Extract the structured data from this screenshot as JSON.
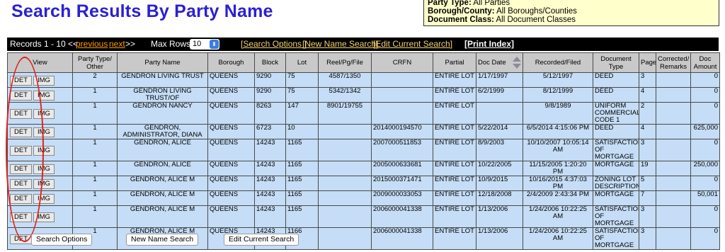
{
  "page": {
    "title": "Search Results By Party Name"
  },
  "criteria": {
    "party_type_label": "Party Type:",
    "party_type_value": "All Parties",
    "borough_label": "Borough/County:",
    "borough_value": "All Boroughs/Counties",
    "doc_class_label": "Document Class:",
    "doc_class_value": "All Document Classes"
  },
  "toolbar": {
    "records": "Records 1 - 10 <<",
    "previous": "previous",
    "next": "next",
    "next_suffix": ">>",
    "max_rows_label": "Max Rows",
    "max_rows_value": "10",
    "search_options": "[Search Options ]",
    "new_name_search": "[New Name Search]",
    "edit_current_search": "[Edit Current Search]",
    "print_index": "[Print Index]"
  },
  "table": {
    "headers": [
      "View",
      "Party Type/ Other",
      "Party Name",
      "Borough",
      "Block",
      "Lot",
      "Reel/Pg/File",
      "CRFN",
      "Partial",
      "Doc Date",
      "Recorded/Filed",
      "Document Type",
      "Pages",
      "Corrected/ Remarks",
      "Doc Amount"
    ],
    "det_label": "DET",
    "img_label": "IMG",
    "rows": [
      {
        "party_type": "2",
        "party_name": "GENDRON LIVING TRUST",
        "borough": "QUEENS",
        "block": "9290",
        "lot": "75",
        "reel": "4587/1350",
        "crfn": "",
        "partial": "ENTIRE LOT",
        "doc_date": "1/17/1997",
        "recorded": "5/12/1997",
        "doc_type": "DEED",
        "pages": "3",
        "remarks": "",
        "amount": "0"
      },
      {
        "party_type": "1",
        "party_name": "GENDRON LIVING TRUST/OF",
        "borough": "QUEENS",
        "block": "9290",
        "lot": "75",
        "reel": "5342/1342",
        "crfn": "",
        "partial": "ENTIRE LOT",
        "doc_date": "6/2/1999",
        "recorded": "8/12/1999",
        "doc_type": "DEED",
        "pages": "4",
        "remarks": "",
        "amount": "0"
      },
      {
        "party_type": "1",
        "party_name": "GENDRON NANCY",
        "borough": "QUEENS",
        "block": "8263",
        "lot": "147",
        "reel": "8901/19755",
        "crfn": "",
        "partial": "ENTIRE LOT",
        "doc_date": "",
        "recorded": "9/8/1989",
        "doc_type": "UNIFORM COMMERCIAL CODE 1",
        "pages": "2",
        "remarks": "",
        "amount": "0"
      },
      {
        "party_type": "1",
        "party_name": "GENDRON, ADMINISTRATOR, DIANA",
        "borough": "QUEENS",
        "block": "6723",
        "lot": "10",
        "reel": "",
        "crfn": "2014000194570",
        "partial": "ENTIRE LOT",
        "doc_date": "5/22/2014",
        "recorded": "6/5/2014 4:15:06 PM",
        "doc_type": "DEED",
        "pages": "4",
        "remarks": "",
        "amount": "625,000"
      },
      {
        "party_type": "1",
        "party_name": "GENDRON, ALICE",
        "borough": "QUEENS",
        "block": "14243",
        "lot": "1165",
        "reel": "",
        "crfn": "2007000511853",
        "partial": "ENTIRE LOT",
        "doc_date": "8/9/2003",
        "recorded": "10/10/2007 10:05:14 AM",
        "doc_type": "SATISFACTION OF MORTGAGE",
        "pages": "3",
        "remarks": "",
        "amount": "0"
      },
      {
        "party_type": "1",
        "party_name": "GENDRON, ALICE",
        "borough": "QUEENS",
        "block": "14243",
        "lot": "1165",
        "reel": "",
        "crfn": "2005000633681",
        "partial": "ENTIRE LOT",
        "doc_date": "10/22/2005",
        "recorded": "11/15/2005 1:20:20 PM",
        "doc_type": "MORTGAGE",
        "pages": "19",
        "remarks": "",
        "amount": "250,000"
      },
      {
        "party_type": "1",
        "party_name": "GENDRON, ALICE M",
        "borough": "QUEENS",
        "block": "14243",
        "lot": "1165",
        "reel": "",
        "crfn": "2015000371471",
        "partial": "ENTIRE LOT",
        "doc_date": "10/9/2015",
        "recorded": "10/16/2015 4:37:03 PM",
        "doc_type": "ZONING LOT DESCRIPTION",
        "pages": "5",
        "remarks": "",
        "amount": "0"
      },
      {
        "party_type": "1",
        "party_name": "GENDRON, ALICE M",
        "borough": "QUEENS",
        "block": "14243",
        "lot": "1165",
        "reel": "",
        "crfn": "2009000033053",
        "partial": "ENTIRE LOT",
        "doc_date": "12/18/2008",
        "recorded": "2/4/2009 2:43:34 PM",
        "doc_type": "MORTGAGE",
        "pages": "7",
        "remarks": "",
        "amount": "50,001"
      },
      {
        "party_type": "1",
        "party_name": "GENDRON, ALICE M",
        "borough": "QUEENS",
        "block": "14243",
        "lot": "1165",
        "reel": "",
        "crfn": "2006000041338",
        "partial": "ENTIRE LOT",
        "doc_date": "1/13/2006",
        "recorded": "1/24/2006 10:22:25 AM",
        "doc_type": "SATISFACTION OF MORTGAGE",
        "pages": "3",
        "remarks": "",
        "amount": "0"
      },
      {
        "party_type": "1",
        "party_name": "GENDRON, ALICE M",
        "borough": "QUEENS",
        "block": "14243",
        "lot": "1166",
        "reel": "",
        "crfn": "2006000041338",
        "partial": "ENTIRE LOT",
        "doc_date": "1/13/2006",
        "recorded": "1/24/2006 10:22:25 AM",
        "doc_type": "SATISFACTION OF MORTGAGE",
        "pages": "3",
        "remarks": "",
        "amount": "0"
      }
    ]
  },
  "bottom": {
    "search_options": "Search Options",
    "new_name_search": "New Name Search",
    "edit_current_search": "Edit Current Search"
  },
  "colors": {
    "title": "#2a1fd6",
    "criteria_bg": "#ffffcc",
    "row_bg": "#c5ddf6",
    "header_bg": "#c9c9c9",
    "link": "#f6d36b",
    "previous": "#ff9a00",
    "annotation_oval": "#e02020"
  }
}
